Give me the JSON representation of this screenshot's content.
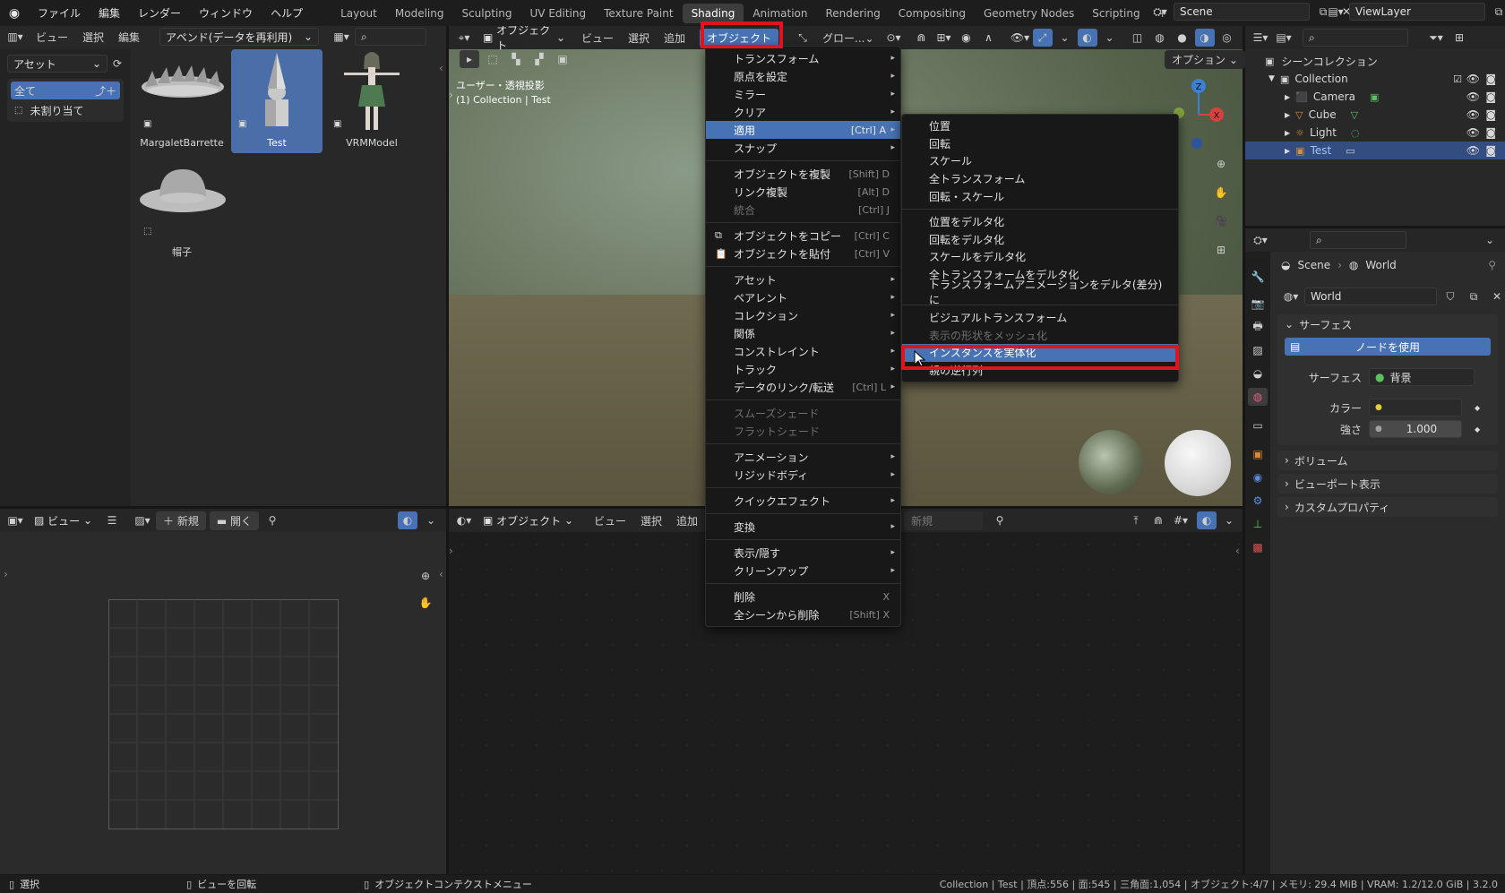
{
  "topbar": {
    "menus": [
      "ファイル",
      "編集",
      "レンダー",
      "ウィンドウ",
      "ヘルプ"
    ],
    "workspaces": [
      "Layout",
      "Modeling",
      "Sculpting",
      "UV Editing",
      "Texture Paint",
      "Shading",
      "Animation",
      "Rendering",
      "Compositing",
      "Geometry Nodes",
      "Scripting"
    ],
    "active_workspace": "Shading",
    "add_ws": "+",
    "scene": "Scene",
    "viewlayer": "ViewLayer"
  },
  "asset_browser": {
    "header": [
      "ビュー",
      "選択",
      "編集"
    ],
    "import_mode": "アペンド(データを再利用)",
    "library": "アセット",
    "catalog_all": "全て",
    "catalog_unassigned": "未割り当て",
    "assets": [
      {
        "name": "MargaletBarrette"
      },
      {
        "name": "Test"
      },
      {
        "name": "VRMModel"
      },
      {
        "name": "帽子"
      }
    ]
  },
  "image_editor": {
    "view": "ビュー",
    "new": "新規",
    "open": "開く"
  },
  "viewport": {
    "mode": "オブジェクト",
    "menus": [
      "ビュー",
      "選択",
      "追加"
    ],
    "object_menu": "オブジェクト",
    "orientation": "グロー...",
    "options": "オプション",
    "overlay_title": "ユーザー・透視投影",
    "overlay_sub": "(1) Collection | Test"
  },
  "node_editor": {
    "mode": "オブジェクト",
    "menus": [
      "ビュー",
      "選択",
      "追加"
    ],
    "new": "新規"
  },
  "object_menu_items": [
    {
      "label": "トランスフォーム",
      "sc": "",
      "arrow": true,
      "dis": false
    },
    {
      "label": "原点を設定",
      "sc": "",
      "arrow": true,
      "dis": false
    },
    {
      "label": "ミラー",
      "sc": "",
      "arrow": true,
      "dis": false
    },
    {
      "label": "クリア",
      "sc": "",
      "arrow": true,
      "dis": false
    },
    {
      "label": "適用",
      "sc": "[Ctrl] A",
      "arrow": true,
      "dis": false,
      "hl": true
    },
    {
      "label": "スナップ",
      "sc": "",
      "arrow": true,
      "dis": false
    },
    {
      "sep": true
    },
    {
      "label": "オブジェクトを複製",
      "sc": "[Shift] D",
      "arrow": false,
      "dis": false
    },
    {
      "label": "リンク複製",
      "sc": "[Alt] D",
      "arrow": false,
      "dis": false
    },
    {
      "label": "統合",
      "sc": "[Ctrl] J",
      "arrow": false,
      "dis": true
    },
    {
      "sep": true
    },
    {
      "label": "オブジェクトをコピー",
      "sc": "[Ctrl] C",
      "arrow": false,
      "dis": false,
      "icon": "copy"
    },
    {
      "label": "オブジェクトを貼付",
      "sc": "[Ctrl] V",
      "arrow": false,
      "dis": false,
      "icon": "paste"
    },
    {
      "sep": true
    },
    {
      "label": "アセット",
      "sc": "",
      "arrow": true,
      "dis": false
    },
    {
      "label": "ペアレント",
      "sc": "",
      "arrow": true,
      "dis": false
    },
    {
      "label": "コレクション",
      "sc": "",
      "arrow": true,
      "dis": false
    },
    {
      "label": "関係",
      "sc": "",
      "arrow": true,
      "dis": false
    },
    {
      "label": "コンストレイント",
      "sc": "",
      "arrow": true,
      "dis": false
    },
    {
      "label": "トラック",
      "sc": "",
      "arrow": true,
      "dis": false
    },
    {
      "label": "データのリンク/転送",
      "sc": "[Ctrl] L",
      "arrow": true,
      "dis": false
    },
    {
      "sep": true
    },
    {
      "label": "スムーズシェード",
      "sc": "",
      "arrow": false,
      "dis": true
    },
    {
      "label": "フラットシェード",
      "sc": "",
      "arrow": false,
      "dis": true
    },
    {
      "sep": true
    },
    {
      "label": "アニメーション",
      "sc": "",
      "arrow": true,
      "dis": false
    },
    {
      "label": "リジッドボディ",
      "sc": "",
      "arrow": true,
      "dis": false
    },
    {
      "sep": true
    },
    {
      "label": "クイックエフェクト",
      "sc": "",
      "arrow": true,
      "dis": false
    },
    {
      "sep": true
    },
    {
      "label": "変換",
      "sc": "",
      "arrow": true,
      "dis": false
    },
    {
      "sep": true
    },
    {
      "label": "表示/隠す",
      "sc": "",
      "arrow": true,
      "dis": false
    },
    {
      "label": "クリーンアップ",
      "sc": "",
      "arrow": true,
      "dis": false
    },
    {
      "sep": true
    },
    {
      "label": "削除",
      "sc": "X",
      "arrow": false,
      "dis": false
    },
    {
      "label": "全シーンから削除",
      "sc": "[Shift] X",
      "arrow": false,
      "dis": false
    }
  ],
  "apply_submenu_items": [
    {
      "label": "位置"
    },
    {
      "label": "回転"
    },
    {
      "label": "スケール"
    },
    {
      "label": "全トランスフォーム"
    },
    {
      "label": "回転・スケール"
    },
    {
      "sep": true
    },
    {
      "label": "位置をデルタ化"
    },
    {
      "label": "回転をデルタ化"
    },
    {
      "label": "スケールをデルタ化"
    },
    {
      "label": "全トランスフォームをデルタ化"
    },
    {
      "label": "トランスフォームアニメーションをデルタ(差分)に"
    },
    {
      "sep": true
    },
    {
      "label": "ビジュアルトランスフォーム"
    },
    {
      "label": "表示の形状をメッシュ化",
      "dis": true
    },
    {
      "label": "インスタンスを実体化",
      "hl": true
    },
    {
      "label": "親の逆行列"
    }
  ],
  "outliner": {
    "title": "シーンコレクション",
    "collection": "Collection",
    "items": [
      {
        "name": "Camera"
      },
      {
        "name": "Cube"
      },
      {
        "name": "Light"
      },
      {
        "name": "Test"
      }
    ]
  },
  "properties": {
    "breadcrumb_scene": "Scene",
    "breadcrumb_world": "World",
    "world_name": "World",
    "surface_panel": "サーフェス",
    "use_nodes": "ノードを使用",
    "surface_label": "サーフェス",
    "surface_value": "背景",
    "color_label": "カラー",
    "strength_label": "強さ",
    "strength_value": "1.000",
    "volume": "ボリューム",
    "viewport_display": "ビューポート表示",
    "custom_props": "カスタムプロパティ"
  },
  "statusbar": {
    "left1": "選択",
    "left2": "ビューを回転",
    "left3": "オブジェクトコンテクストメニュー",
    "right": "Collection | Test | 頂点:556 | 面:545 | 三角面:1,054 | オブジェクト:4/7 | メモリ: 29.4 MiB | VRAM: 1.2/12.0 GiB | 3.2.0"
  }
}
